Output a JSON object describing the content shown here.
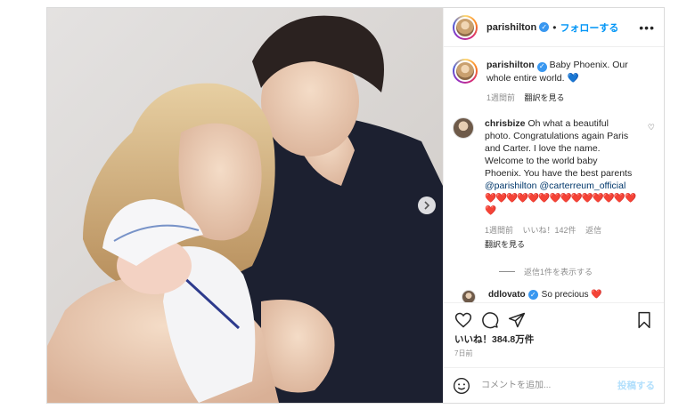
{
  "header": {
    "username": "parishilton",
    "verified_mark": "✓",
    "separator": "•",
    "follow_label": "フォローする",
    "more_label": "•••"
  },
  "caption": {
    "username": "parishilton",
    "text": "Baby Phoenix. Our whole entire world. 💙",
    "time": "1週間前",
    "translate": "翻訳を見る"
  },
  "comments": [
    {
      "username": "chrisbize",
      "text_before": "Oh what a beautiful photo. Congratulations again Paris and Carter. I love the name. Welcome to the world baby Phoenix. You have the best parents ",
      "mention1": "@parishilton",
      "mention2": "@carterreum_official",
      "hearts": "❤️❤️❤️❤️❤️❤️❤️❤️❤️❤️❤️❤️❤️❤️❤️",
      "time": "1週間前",
      "likes": "いいね！142件",
      "reply": "返信",
      "translate": "翻訳を見る",
      "view_replies": "返信1件を表示する"
    },
    {
      "username": "ddlovato",
      "text": "So precious ❤️"
    }
  ],
  "actions": {
    "like_icon": "heart-outline",
    "comment_icon": "comment-bubble",
    "share_icon": "paper-plane",
    "save_icon": "bookmark"
  },
  "likes_count": "いいね！384.8万件",
  "posted_ago": "7日前",
  "add_comment": {
    "placeholder": "コメントを追加...",
    "post_label": "投稿する"
  },
  "colors": {
    "accent": "#0095f6",
    "verified": "#3897f0",
    "heart": "#ed4956",
    "post_disabled": "#b2dffc"
  }
}
